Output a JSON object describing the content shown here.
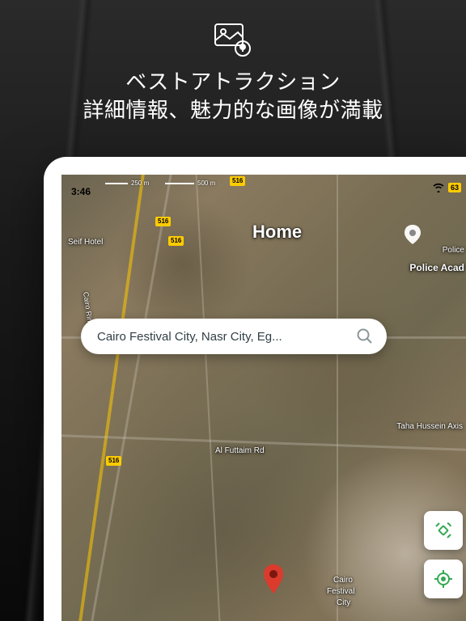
{
  "hero": {
    "line1": "ベストアトラクション",
    "line2": "詳細情報、魅力的な画像が満載"
  },
  "status": {
    "time": "3:46",
    "battery": "63"
  },
  "map": {
    "scale": {
      "s1": "250 m",
      "s2": "500 m"
    },
    "highway": "516",
    "home_label": "Home",
    "labels": {
      "seif": "Seif Hotel",
      "police": "Police Acad",
      "police_drop": "Police",
      "taha": "Taha Hussein Axis",
      "futtaim": "Al Futtaim Rd",
      "ring": "Cairo Ring Rd",
      "cfc1": "Cairo",
      "cfc2": "Festival",
      "cfc3": "City"
    }
  },
  "search": {
    "query": "Cairo Festival City, Nasr City, Eg..."
  },
  "colors": {
    "accent": "#34a853",
    "pin": "#da3b2c",
    "highway": "#ffcc00"
  }
}
